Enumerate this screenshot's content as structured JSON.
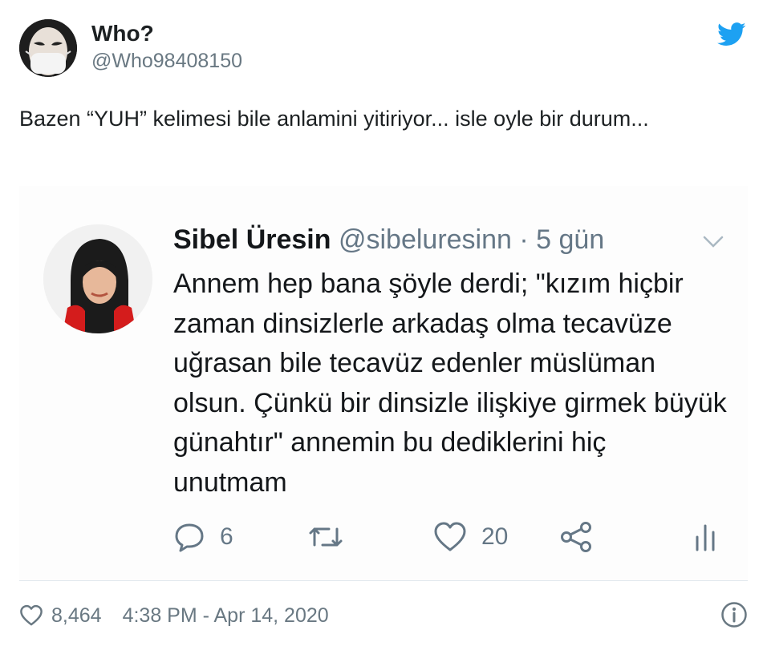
{
  "tweet": {
    "author": {
      "display_name": "Who?",
      "handle": "@Who98408150"
    },
    "text": "Bazen “YUH” kelimesi bile anlamini yitiriyor... isle oyle bir durum...",
    "likes": "8,464",
    "timestamp": "4:38 PM - Apr 14, 2020"
  },
  "quoted": {
    "author": {
      "display_name": "Sibel Üresin",
      "handle": "@sibeluresinn",
      "separator": "·",
      "age": "5 gün"
    },
    "text": "Annem hep bana şöyle derdi; \"kızım hiçbir zaman dinsizlerle arkadaş olma tecavüze uğrasan bile tecavüz edenler müslüman olsun. Çünkü bir dinsizle ilişkiye girmek büyük günahtır\" annemin bu dediklerini hiç unutmam",
    "replies": "6",
    "likes": "20"
  },
  "icons": {
    "brand": "twitter-bird-icon",
    "menu": "chevron-down-icon",
    "reply": "reply-icon",
    "retweet": "retweet-icon",
    "like": "heart-icon",
    "share": "share-icon",
    "analytics": "analytics-icon",
    "info": "info-icon"
  },
  "colors": {
    "brand": "#1da1f2",
    "muted": "#657786",
    "text": "#1c2022"
  }
}
